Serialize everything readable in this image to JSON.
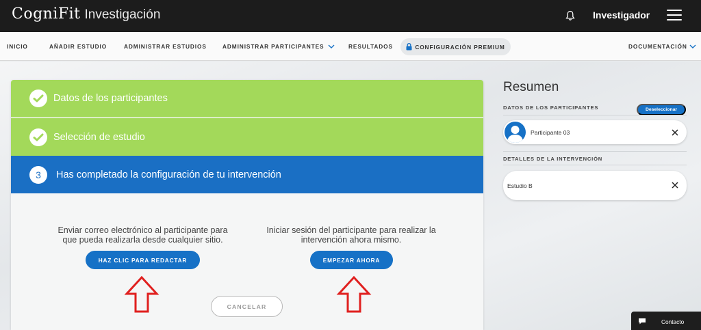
{
  "header": {
    "brand": "CogniFit",
    "subtitle": "Investigación",
    "user": "Investigador",
    "icons": {
      "notifications": "bell-icon",
      "menu": "hamburger-icon"
    }
  },
  "nav": {
    "items": [
      "INICIO",
      "AÑADIR ESTUDIO",
      "ADMINISTRAR ESTUDIOS",
      "ADMINISTRAR PARTICIPANTES",
      "RESULTADOS"
    ],
    "premium": "CONFIGURACIÓN PREMIUM",
    "docs": "DOCUMENTACIÓN"
  },
  "steps": [
    {
      "label": "Datos de los participantes",
      "state": "done"
    },
    {
      "label": "Selección de estudio",
      "state": "done"
    },
    {
      "number": "3",
      "label": "Has completado la configuración de tu intervención",
      "state": "active"
    }
  ],
  "options": {
    "email": {
      "text": "Enviar correo electrónico al participante para que pueda realizarla desde cualquier sitio.",
      "button": "HAZ CLIC PARA REDACTAR"
    },
    "now": {
      "text": "Iniciar sesión del participante para realizar la intervención ahora mismo.",
      "button": "EMPEZAR AHORA"
    },
    "cancel": "CANCELAR"
  },
  "summary": {
    "title": "Resumen",
    "participants_label": "DATOS DE LOS PARTICIPANTES",
    "deselect": "Deseleccionar",
    "participant": "Participante 03",
    "intervention_label": "DETALLES DE LA INTERVENCIÓN",
    "study": "Estudio B"
  },
  "contact": "Contacto",
  "colors": {
    "green": "#a3d95a",
    "blue": "#1671c6",
    "arrow_red": "#e0201f",
    "topbar": "#1c1c1c"
  }
}
